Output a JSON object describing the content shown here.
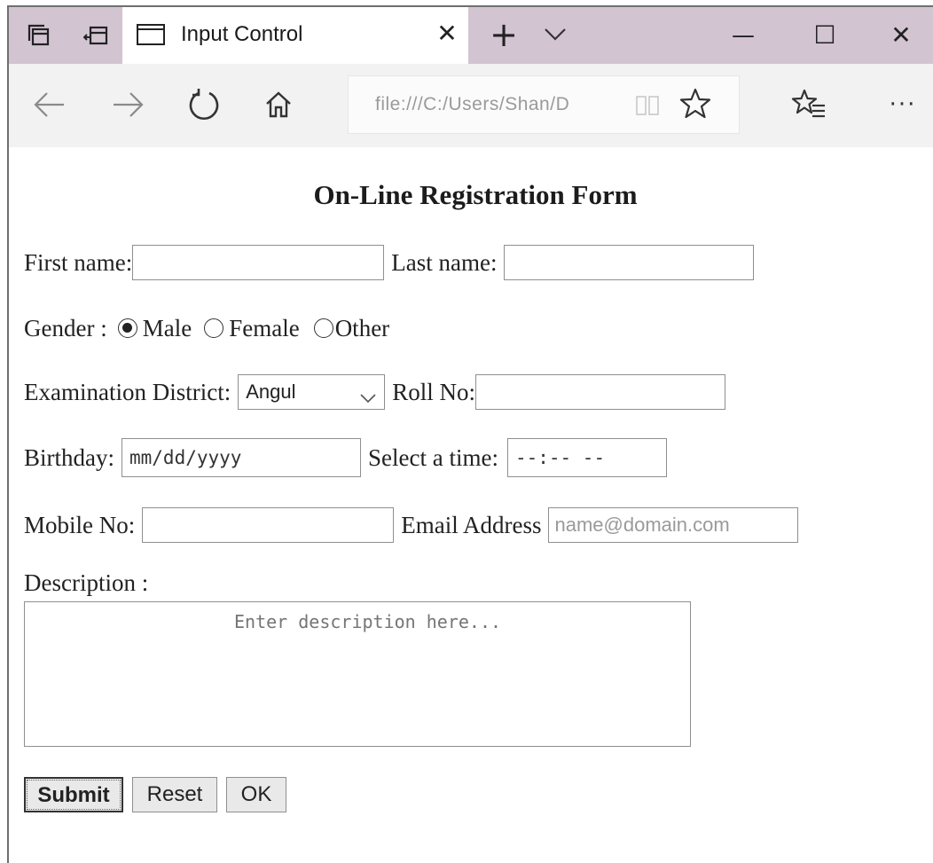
{
  "browser": {
    "tab": {
      "title": "Input Control",
      "close_glyph": "✕"
    },
    "new_tab_glyph": "+",
    "window_controls": {
      "minimize_glyph": "—",
      "maximize_glyph": "☐",
      "close_glyph": "✕"
    },
    "address": {
      "url": "file:///C:/Users/Shan/D"
    },
    "more_glyph": "···",
    "icons": [
      "set-aside-tabs-icon",
      "show-tab-previews-icon",
      "page-icon",
      "chevron-down-icon",
      "back-arrow-icon",
      "forward-arrow-icon",
      "refresh-icon",
      "home-icon",
      "reading-view-icon",
      "favorite-star-icon",
      "favorites-hub-icon",
      "more-icon"
    ]
  },
  "form": {
    "title": "On-Line Registration Form",
    "first_name_label": "First name:",
    "last_name_label": "Last name:",
    "gender_label": "Gender :",
    "gender_options": [
      "Male",
      "Female",
      "Other"
    ],
    "gender_selected": "Male",
    "district_label": "Examination District:",
    "district_value": "Angul",
    "roll_label": "Roll No:",
    "birthday_label": "Birthday:",
    "birthday_placeholder": "mm/dd/yyyy",
    "time_label": "Select a time:",
    "time_placeholder": "--:-- --",
    "mobile_label": "Mobile No:",
    "email_label": "Email Address",
    "email_placeholder": "name@domain.com",
    "description_label": "Description :",
    "description_placeholder": "Enter description here...",
    "buttons": {
      "submit": "Submit",
      "reset": "Reset",
      "ok": "OK"
    }
  },
  "colors": {
    "tab_strip": "#d3c4d2",
    "nav_bar": "#f2f2f2",
    "field_border": "#8f8f8f"
  }
}
